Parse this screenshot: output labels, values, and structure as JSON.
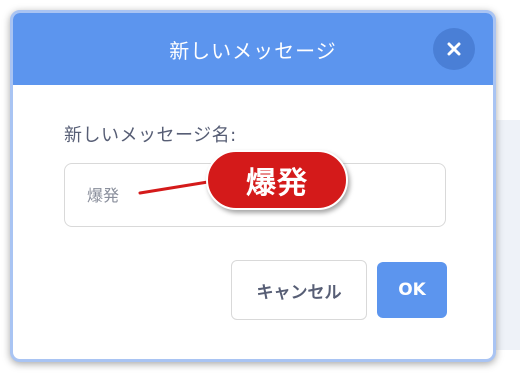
{
  "dialog": {
    "title": "新しいメッセージ",
    "close_icon": "close-icon",
    "field_label": "新しいメッセージ名:",
    "input": {
      "value": "",
      "placeholder": "爆発"
    },
    "cancel_label": "キャンセル",
    "ok_label": "OK"
  },
  "annotation": {
    "text": "爆発",
    "color": "#d41a1a"
  },
  "colors": {
    "header": "#5c95ee",
    "close_button": "#4a7fd6",
    "ok_button": "#5c95ee",
    "text": "#575e75"
  }
}
